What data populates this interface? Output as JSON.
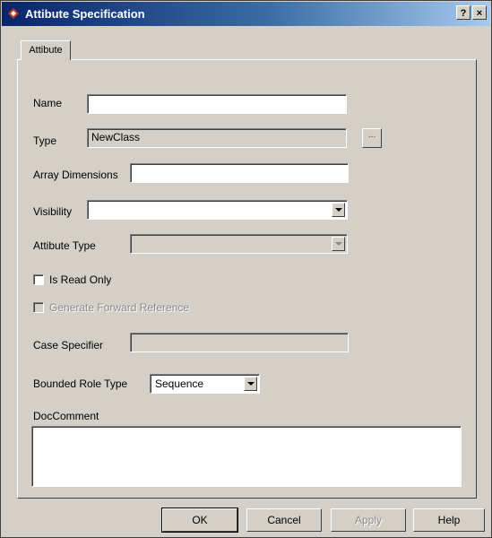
{
  "window": {
    "title": "Attibute Specification",
    "help_button": "?",
    "close_button": "×"
  },
  "tabs": [
    {
      "label": "Attibute",
      "selected": true
    }
  ],
  "form": {
    "name": {
      "label": "Name",
      "value": ""
    },
    "type": {
      "label": "Type",
      "value": "NewClass",
      "browse_label": "..."
    },
    "array_dimensions": {
      "label": "Array Dimensions",
      "value": ""
    },
    "visibility": {
      "label": "Visibility",
      "selected": ""
    },
    "attribute_type": {
      "label": "Attibute Type",
      "selected": ""
    },
    "is_read_only": {
      "label": "Is Read Only",
      "checked": false
    },
    "generate_forward_reference": {
      "label": "Generate Forward Reference",
      "checked": false,
      "disabled": true
    },
    "case_specifier": {
      "label": "Case Specifier",
      "value": ""
    },
    "bounded_role_type": {
      "label": "Bounded Role Type",
      "selected": "Sequence"
    },
    "doc_comment": {
      "label": "DocComment",
      "value": ""
    }
  },
  "buttons": {
    "ok": "OK",
    "cancel": "Cancel",
    "apply": "Apply",
    "help": "Help"
  },
  "colors": {
    "dialog_face": "#d4d0c8",
    "titlebar_start": "#0a246a",
    "titlebar_end": "#a6caf0",
    "title_icon": "#c0392b"
  }
}
